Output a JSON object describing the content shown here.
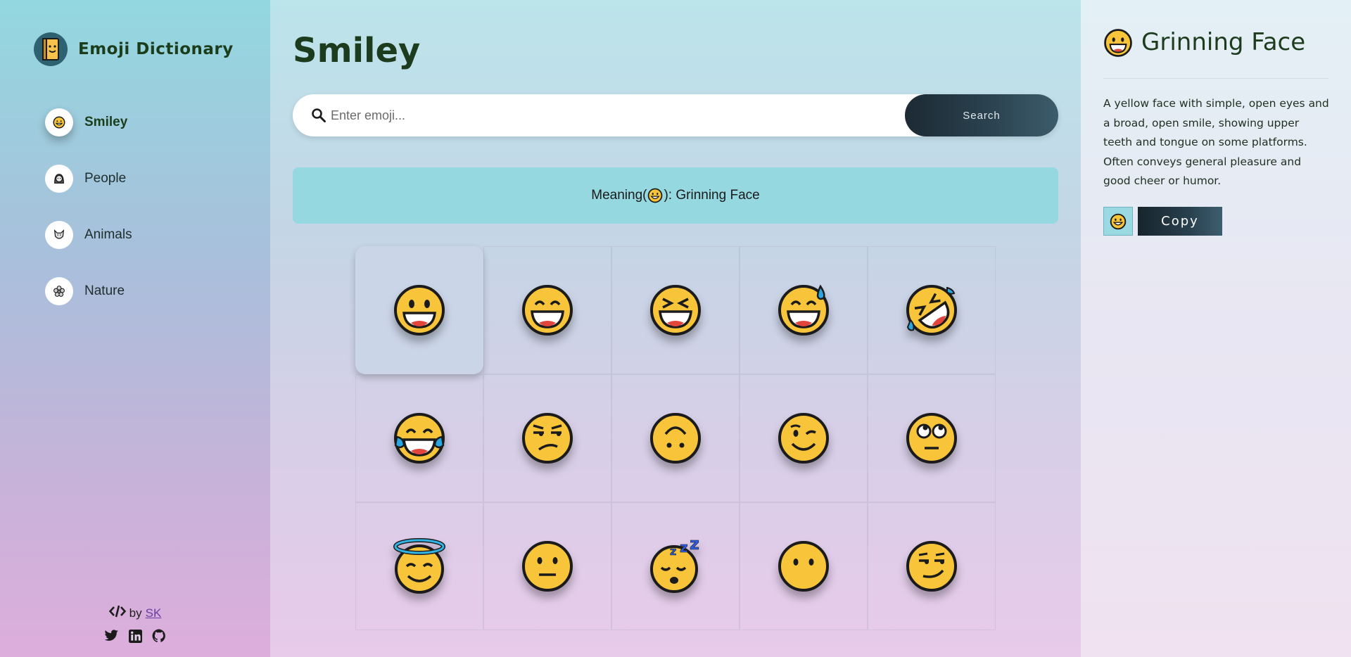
{
  "app": {
    "title": "Emoji Dictionary",
    "logo_icon": "book-with-face-icon"
  },
  "sidebar": {
    "items": [
      {
        "label": "Smiley",
        "icon": "😀",
        "active": true
      },
      {
        "label": "People",
        "icon": "👩",
        "active": false
      },
      {
        "label": "Animals",
        "icon": "🐺",
        "active": false
      },
      {
        "label": "Nature",
        "icon": "🌸",
        "active": false
      }
    ]
  },
  "footer": {
    "by_text": "by",
    "author": "SK",
    "socials": [
      "twitter-icon",
      "linkedin-icon",
      "github-icon"
    ]
  },
  "main": {
    "title": "Smiley",
    "search": {
      "placeholder": "Enter emoji...",
      "value": "",
      "button_label": "Search"
    },
    "meaning": {
      "prefix": "Meaning(",
      "emoji": "😀",
      "suffix": "): Grinning Face"
    },
    "emojis": [
      {
        "char": "😀",
        "name": "grinning-face",
        "selected": true
      },
      {
        "char": "😄",
        "name": "grinning-face-with-smiling-eyes"
      },
      {
        "char": "😆",
        "name": "grinning-squinting-face"
      },
      {
        "char": "😅",
        "name": "grinning-face-with-sweat"
      },
      {
        "char": "🤣",
        "name": "rolling-on-the-floor-laughing"
      },
      {
        "char": "😂",
        "name": "face-with-tears-of-joy"
      },
      {
        "char": "😒",
        "name": "unamused-face"
      },
      {
        "char": "🙃",
        "name": "upside-down-face"
      },
      {
        "char": "😉",
        "name": "winking-face"
      },
      {
        "char": "🙄",
        "name": "face-with-rolling-eyes"
      },
      {
        "char": "😇",
        "name": "smiling-face-with-halo"
      },
      {
        "char": "😐",
        "name": "neutral-face"
      },
      {
        "char": "😴",
        "name": "sleeping-face"
      },
      {
        "char": "😶",
        "name": "face-without-mouth"
      },
      {
        "char": "😏",
        "name": "smirking-face"
      }
    ]
  },
  "detail": {
    "emoji": "😀",
    "title": "Grinning Face",
    "description": "A yellow face with simple, open eyes and a broad, open smile, showing upper teeth and tongue on some platforms. Often conveys general pleasure and good cheer or humor.",
    "copy_label": "Copy"
  },
  "colors": {
    "accent_dark": "#1c2a33",
    "title_green": "#1d3c1d",
    "meaning_bg": "#95d8e0",
    "emoji_yellow": "#f8c53a"
  }
}
